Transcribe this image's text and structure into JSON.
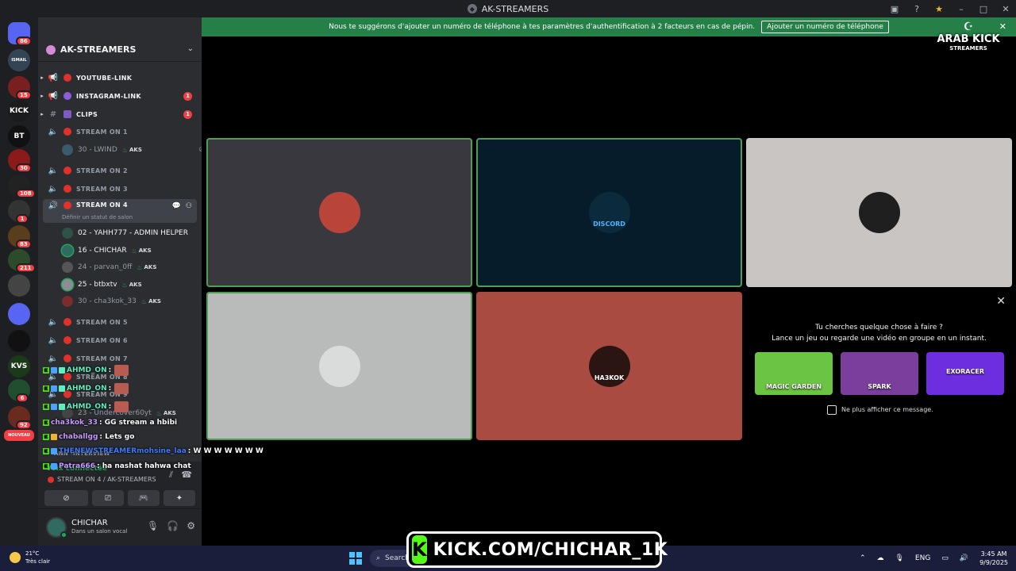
{
  "window": {
    "title": "AK-STREAMERS"
  },
  "notice": {
    "text": "Nous te suggérons d'ajouter un numéro de téléphone à tes paramètres d'authentification à 2 facteurs en cas de pépin.",
    "button": "Ajouter un numéro de téléphone"
  },
  "watermark": {
    "line1": "ARAB KICK",
    "line2": "STREAMERS"
  },
  "rail": [
    {
      "label": "",
      "badge": "86",
      "top": 0
    },
    {
      "label": "ISMAIL",
      "badge": "",
      "top": 0
    },
    {
      "label": "",
      "badge": "15",
      "top": 0
    },
    {
      "label": "KICK",
      "badge": "",
      "top": 0
    },
    {
      "label": "BT",
      "badge": "",
      "top": 0
    },
    {
      "label": "",
      "badge": "30",
      "top": 0
    },
    {
      "label": "",
      "badge": "108",
      "top": 0
    },
    {
      "label": "",
      "badge": "1",
      "top": 0
    },
    {
      "label": "",
      "badge": "83",
      "top": 0
    },
    {
      "label": "",
      "badge": "211",
      "top": 0
    },
    {
      "label": "",
      "badge": "",
      "top": 0
    },
    {
      "label": "",
      "badge": "",
      "top": 0
    },
    {
      "label": "",
      "badge": "",
      "top": 0
    },
    {
      "label": "KVS",
      "badge": "",
      "top": 0
    },
    {
      "label": "",
      "badge": "6",
      "top": 0
    },
    {
      "label": "",
      "badge": "92",
      "top": 0
    },
    {
      "label": "NOUVEAU",
      "badge": "",
      "top": 0
    }
  ],
  "server": {
    "name": "AK-STREAMERS"
  },
  "channels": [
    {
      "name": "YOUTUBE-LINK",
      "badge": ""
    },
    {
      "name": "INSTAGRAM-LINK",
      "badge": "1"
    },
    {
      "name": "CLIPS",
      "badge": "1"
    },
    {
      "name": "STREAM ON 1",
      "badge": ""
    },
    {
      "name": "STREAM ON 2",
      "badge": ""
    },
    {
      "name": "STREAM ON 3",
      "badge": ""
    },
    {
      "name": "STREAM ON 4",
      "badge": ""
    },
    {
      "name": "STREAM ON 5",
      "badge": ""
    },
    {
      "name": "STREAM ON 6",
      "badge": ""
    },
    {
      "name": "STREAM ON 7",
      "badge": ""
    },
    {
      "name": "STREAM ON 8",
      "badge": ""
    },
    {
      "name": "STREAM ON 9",
      "badge": ""
    }
  ],
  "status_hint": "Définir un statut de salon",
  "stream1_user": {
    "name": "30 - LWIND",
    "tag": "AKS"
  },
  "stream4_users": [
    {
      "name": "02 - YAHH777 - ADMIN HELPER",
      "tag": ""
    },
    {
      "name": "16 - CHICHAR",
      "tag": "AKS"
    },
    {
      "name": "24 - parvan_0ff",
      "tag": "AKS"
    },
    {
      "name": "25 - btbxtv",
      "tag": "AKS"
    },
    {
      "name": "30 - cha3kok_33",
      "tag": "AKS"
    }
  ],
  "chat": [
    {
      "user": "AHMD_ON",
      "msg": ":",
      "color": "#5cf0c0"
    },
    {
      "user": "AHMD_ON",
      "msg": ":",
      "color": "#5cf0c0"
    },
    {
      "user": "AHMD_ON",
      "msg": ":",
      "color": "#5cf0c0"
    },
    {
      "user": "cha3kok_33",
      "msg": ": GG stream a hbibi",
      "color": "#c79bff"
    },
    {
      "user": "chaballgg",
      "msg": ": Lets go",
      "color": "#c79bff"
    },
    {
      "user": "THENEWSTREAMERmohsine_laa",
      "msg": ": W W W W W W W",
      "color": "#3c7cff"
    },
    {
      "user": "Patra666",
      "msg": ": ha nashat hahwa chat",
      "color": "#c79bff"
    }
  ],
  "bg_text": {
    "undercover": "23 - Undercover60yt",
    "interview": "ANN -INTERVIEW"
  },
  "voice": {
    "status": "Voix connectée",
    "location": "STREAM ON 4 / AK-STREAMERS"
  },
  "user": {
    "name": "CHICHAR",
    "status": "Dans un salon vocal"
  },
  "tiles": [
    {
      "bg": "#3a383f",
      "speaking": true,
      "av": "#b8443a"
    },
    {
      "bg": "#071c2b",
      "speaking": true,
      "av": "#0b2a3c",
      "label": "DISCORD"
    },
    {
      "bg": "#c8c5c3",
      "speaking": false,
      "av": "#1f1f1f"
    },
    {
      "bg": "#b8bbb9",
      "speaking": true,
      "av": "#d9dcdb"
    },
    {
      "bg": "#a94b40",
      "speaking": false,
      "av": "#2b1512",
      "label": "HA3KOK"
    }
  ],
  "activity": {
    "q1": "Tu cherches quelque chose à faire ?",
    "q2": "Lance un jeu ou regarde une vidéo en groupe en un instant.",
    "games": [
      {
        "name": "MAGIC GARDEN",
        "color": "#6cc443"
      },
      {
        "name": "SPARK",
        "color": "#7a3f9c"
      },
      {
        "name": "EXORACER",
        "color": "#6d2ee0"
      }
    ],
    "checkbox_label": "Ne plus afficher ce message."
  },
  "taskbar": {
    "temp": "21°C",
    "weather": "Très clair",
    "search": "Search",
    "lang": "ENG",
    "time": "3:45 AM",
    "date": "9/9/2025"
  },
  "kick_banner": {
    "text": "KICK.COM/CHICHAR_1K",
    "letter": "K"
  },
  "colors": {
    "accent_green": "#248046",
    "kick_green": "#53fc18",
    "danger": "#f23f43"
  }
}
